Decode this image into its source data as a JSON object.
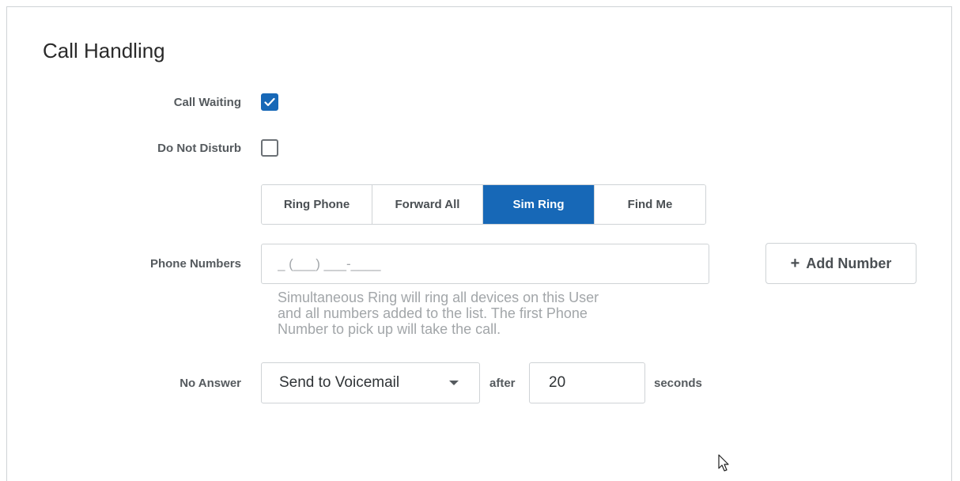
{
  "page": {
    "title": "Call Handling"
  },
  "call_waiting": {
    "label": "Call Waiting",
    "checked": true
  },
  "do_not_disturb": {
    "label": "Do Not Disturb",
    "checked": false
  },
  "mode_tabs": {
    "options": [
      "Ring Phone",
      "Forward All",
      "Sim Ring",
      "Find Me"
    ],
    "selected": "Sim Ring"
  },
  "phone_numbers": {
    "label": "Phone Numbers",
    "placeholder": "_ (___) ___-____",
    "value": "",
    "add_button_label": "Add Number",
    "help_text": "Simultaneous Ring will ring all devices on this User\nand all numbers added to the list. The first Phone\nNumber to pick up will take the call."
  },
  "no_answer": {
    "label": "No Answer",
    "selected_option": "Send to Voicemail",
    "after_label": "after",
    "seconds_value": "20",
    "seconds_label": "seconds"
  },
  "colors": {
    "accent": "#1768b7",
    "border": "#cfd3d6",
    "label_text": "#555a5e",
    "help_text": "#a2a6a9"
  },
  "icons": {
    "checkmark": "check-icon",
    "add": "plus-icon",
    "dropdown": "caret-down-icon",
    "cursor": "mouse-pointer-icon"
  }
}
